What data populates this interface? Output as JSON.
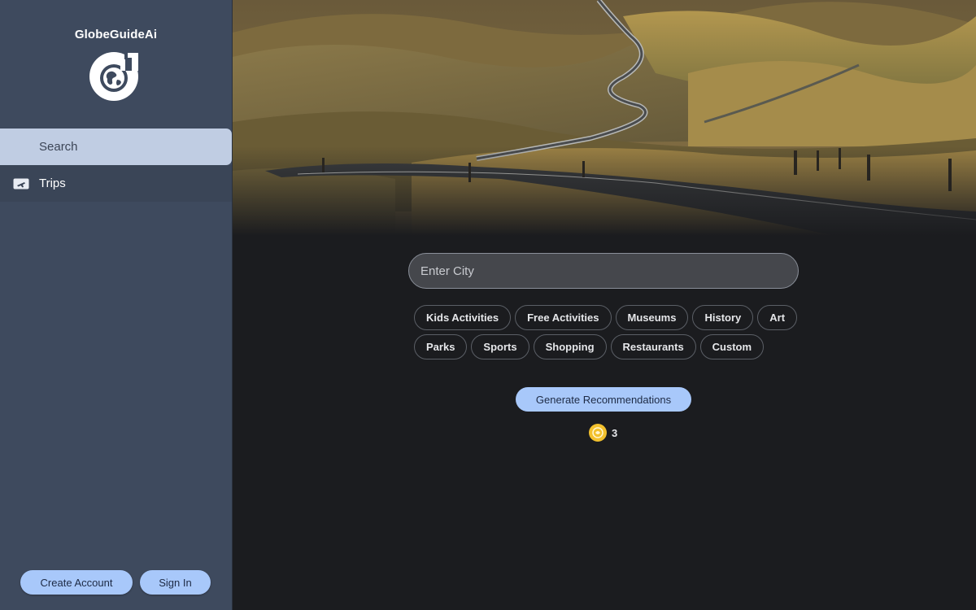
{
  "brand": {
    "name": "GlobeGuideAi",
    "logo_icon": "globe-logo-icon"
  },
  "sidebar": {
    "items": [
      {
        "label": "Search",
        "icon": "search-icon",
        "active": true
      },
      {
        "label": "Trips",
        "icon": "plane-ticket-icon",
        "active": false
      }
    ],
    "create_account_label": "Create Account",
    "sign_in_label": "Sign In"
  },
  "hero": {
    "image": "winding-road-landscape"
  },
  "search": {
    "placeholder": "Enter City",
    "value": ""
  },
  "categories": {
    "row1": [
      "Kids Activities",
      "Free Activities",
      "Museums",
      "History",
      "Art"
    ],
    "row2": [
      "Parks",
      "Sports",
      "Shopping",
      "Restaurants",
      "Custom"
    ]
  },
  "generate": {
    "label": "Generate Recommendations"
  },
  "credits": {
    "icon": "coin-icon",
    "count": "3"
  },
  "colors": {
    "sidebar_bg": "#3e4a5e",
    "active_item_bg": "#c0cde3",
    "accent_button": "#a8c8fa",
    "main_bg": "#1b1c1f",
    "coin": "#f3c12d"
  }
}
